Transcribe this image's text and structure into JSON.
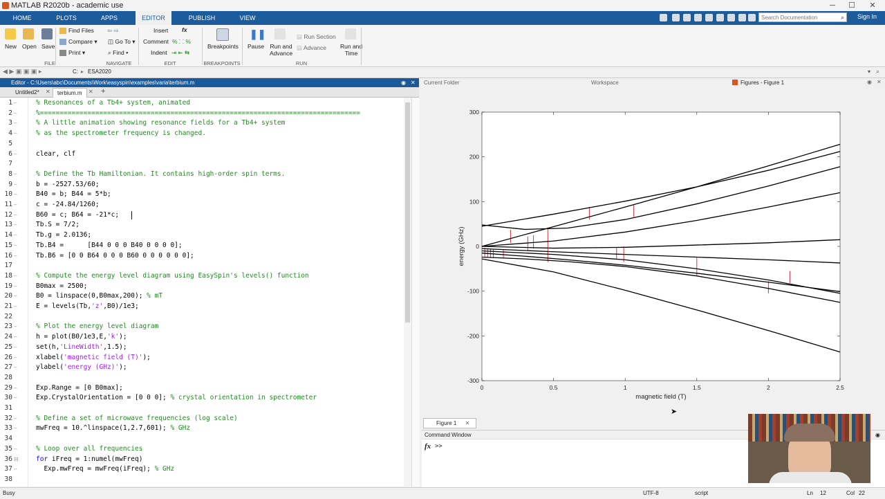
{
  "window": {
    "title": "MATLAB R2020b - academic use",
    "min": "─",
    "max": "☐",
    "close": "✕"
  },
  "ribbon": {
    "tabs": [
      "HOME",
      "PLOTS",
      "APPS",
      "EDITOR",
      "PUBLISH",
      "VIEW"
    ],
    "active_tab": "EDITOR",
    "search_placeholder": "Search Documentation",
    "sign_in": "Sign In"
  },
  "toolstrip": {
    "file": {
      "new": "New",
      "open": "Open",
      "save": "Save",
      "group": "FILE"
    },
    "navigate": {
      "find_files": "Find Files",
      "compare": "Compare",
      "print": "Print",
      "go_to": "Go To",
      "find": "Find",
      "group": "NAVIGATE"
    },
    "edit": {
      "insert": "Insert",
      "comment": "Comment",
      "indent": "Indent",
      "fx": "fx",
      "group": "EDIT"
    },
    "breakpoints": {
      "label": "Breakpoints",
      "group": "BREAKPOINTS"
    },
    "run": {
      "pause": "Pause",
      "run_advance_1": "Run and",
      "run_advance_2": "Advance",
      "run_section": "Run Section",
      "advance": "Advance",
      "run_time_1": "Run and",
      "run_time_2": "Time",
      "group": "RUN"
    }
  },
  "address": {
    "drive": "C:",
    "folder": "ESA2020"
  },
  "editor": {
    "title": "Editor - C:\\Users\\abc\\Documents\\Work\\easyspin\\examples\\varia\\terbium.m",
    "tabs": [
      "Untitled2*",
      "terbium.m"
    ],
    "active_tab": "terbium.m",
    "lines": [
      {
        "n": "1",
        "c": "% Resonances of a Tb4+ system, animated",
        "t": "cmt"
      },
      {
        "n": "2",
        "c": "%=================================================================================",
        "t": "cmt"
      },
      {
        "n": "3",
        "c": "% A little animation showing resonance fields for a Tb4+ system",
        "t": "cmt"
      },
      {
        "n": "4",
        "c": "% as the spectrometer frequency is changed.",
        "t": "cmt"
      },
      {
        "n": "5",
        "c": "",
        "t": ""
      },
      {
        "n": "6",
        "c": "clear, clf",
        "t": ""
      },
      {
        "n": "7",
        "c": "",
        "t": ""
      },
      {
        "n": "8",
        "c": "% Define the Tb Hamiltonian. It contains high-order spin terms.",
        "t": "cmt"
      },
      {
        "n": "9",
        "c": "b = -2527.53/60;",
        "t": ""
      },
      {
        "n": "10",
        "c": "B40 = b; B44 = 5*b;",
        "t": ""
      },
      {
        "n": "11",
        "c": "c = -24.84/1260;",
        "t": ""
      },
      {
        "n": "12",
        "c": "B60 = c; B64 = -21*c;",
        "t": ""
      },
      {
        "n": "13",
        "c": "Tb.S = 7/2;",
        "t": ""
      },
      {
        "n": "14",
        "c": "Tb.g = 2.0136;",
        "t": ""
      },
      {
        "n": "15",
        "c": "Tb.B4 =      [B44 0 0 0 B40 0 0 0 0];",
        "t": ""
      },
      {
        "n": "16",
        "c": "Tb.B6 = [0 0 B64 0 0 0 B60 0 0 0 0 0 0];",
        "t": ""
      },
      {
        "n": "17",
        "c": "",
        "t": ""
      },
      {
        "n": "18",
        "c": "% Compute the energy level diagram using EasySpin's levels() function",
        "t": "cmt"
      },
      {
        "n": "19",
        "c": "B0max = 2500;",
        "t": ""
      },
      {
        "n": "20",
        "c": "B0 = linspace(0,B0max,200); % mT",
        "t": "mixcmt",
        "p1": "B0 = linspace(0,B0max,200); ",
        "p2": "% mT"
      },
      {
        "n": "21",
        "c": "E = levels(Tb,'z',B0)/1e3;",
        "t": "mixstr",
        "p1": "E = levels(Tb,",
        "p2": "'z'",
        "p3": ",B0)/1e3;"
      },
      {
        "n": "22",
        "c": "",
        "t": ""
      },
      {
        "n": "23",
        "c": "% Plot the energy level diagram",
        "t": "cmt"
      },
      {
        "n": "24",
        "c": "h = plot(B0/1e3,E,'k');",
        "t": "mixstr",
        "p1": "h = plot(B0/1e3,E,",
        "p2": "'k'",
        "p3": ");"
      },
      {
        "n": "25",
        "c": "set(h,'LineWidth',1.5);",
        "t": "mixstr",
        "p1": "set(h,",
        "p2": "'LineWidth'",
        "p3": ",1.5);"
      },
      {
        "n": "26",
        "c": "xlabel('magnetic field (T)');",
        "t": "mixstr",
        "p1": "xlabel(",
        "p2": "'magnetic field (T)'",
        "p3": ");"
      },
      {
        "n": "27",
        "c": "ylabel('energy (GHz)');",
        "t": "mixstr",
        "p1": "ylabel(",
        "p2": "'energy (GHz)'",
        "p3": ");"
      },
      {
        "n": "28",
        "c": "",
        "t": ""
      },
      {
        "n": "29",
        "c": "Exp.Range = [0 B0max];",
        "t": ""
      },
      {
        "n": "30",
        "c": "Exp.CrystalOrientation = [0 0 0]; % crystal orientation in spectrometer",
        "t": "mixcmt",
        "p1": "Exp.CrystalOrientation = [0 0 0]; ",
        "p2": "% crystal orientation in spectrometer"
      },
      {
        "n": "31",
        "c": "",
        "t": ""
      },
      {
        "n": "32",
        "c": "% Define a set of microwave frequencies (log scale)",
        "t": "cmt"
      },
      {
        "n": "33",
        "c": "mwFreq = 10.^linspace(1,2.7,601); % GHz",
        "t": "mixcmt",
        "p1": "mwFreq = 10.^linspace(1,2.7,601); ",
        "p2": "% GHz"
      },
      {
        "n": "34",
        "c": "",
        "t": ""
      },
      {
        "n": "35",
        "c": "% Loop over all frequencies",
        "t": "cmt"
      },
      {
        "n": "36",
        "c": "for iFreq = 1:numel(mwFreq)",
        "t": "mixkw",
        "p1": "for",
        "p2": " iFreq = 1:numel(mwFreq)"
      },
      {
        "n": "37",
        "c": "  Exp.mwFreq = mwFreq(iFreq); % GHz",
        "t": "mixcmt",
        "p1": "  Exp.mwFreq = mwFreq(iFreq); ",
        "p2": "% GHz"
      },
      {
        "n": "38",
        "c": "",
        "t": ""
      }
    ]
  },
  "panels": {
    "current_folder": "Current Folder",
    "workspace": "Workspace",
    "figures": "Figures - Figure 1",
    "figure_tab": "Figure 1"
  },
  "command_window": {
    "title": "Command Window",
    "prompt": ">>",
    "fx": "fx"
  },
  "status": {
    "left": "Busy",
    "encoding": "UTF-8",
    "type": "script",
    "ln_label": "Ln",
    "ln": "12",
    "col_label": "Col",
    "col": "22"
  },
  "chart_data": {
    "type": "line",
    "xlabel": "magnetic field (T)",
    "ylabel": "energy (GHz)",
    "xlim": [
      0,
      2.5
    ],
    "ylim": [
      -300,
      300
    ],
    "xticks": [
      "0",
      "0.5",
      "1",
      "1.5",
      "2",
      "2.5"
    ],
    "yticks": [
      "-300",
      "-200",
      "-100",
      "0",
      "100",
      "200",
      "300"
    ],
    "line_color": "#000000",
    "marker_color": "#d8323c",
    "series": [
      {
        "x": [
          0,
          0.3,
          0.6,
          1.0,
          1.5,
          2.0,
          2.5
        ],
        "y": [
          48,
          38,
          41,
          60,
          95,
          135,
          178
        ]
      },
      {
        "x": [
          0,
          0.5,
          1.0,
          1.5,
          2.0,
          2.5
        ],
        "y": [
          0,
          44,
          88,
          133,
          180,
          228
        ]
      },
      {
        "x": [
          0,
          0.5,
          1.0,
          1.5,
          2.0,
          2.5
        ],
        "y": [
          45,
          72,
          101,
          133,
          170,
          212
        ]
      },
      {
        "x": [
          0,
          0.5,
          1.0,
          1.5,
          2.0,
          2.5
        ],
        "y": [
          0,
          12,
          32,
          58,
          88,
          120
        ]
      },
      {
        "x": [
          0,
          0.5,
          1.0,
          1.5,
          2.0,
          2.5
        ],
        "y": [
          0,
          -4,
          -2,
          3,
          8,
          15
        ]
      },
      {
        "x": [
          0,
          0.5,
          1.0,
          1.5,
          2.0,
          2.5
        ],
        "y": [
          -5,
          -12,
          -18,
          -24,
          -30,
          -37
        ]
      },
      {
        "x": [
          0,
          0.3,
          0.6,
          1.0,
          1.5,
          2.0,
          2.5
        ],
        "y": [
          -15,
          -22,
          -30,
          -42,
          -60,
          -80,
          -101
        ]
      },
      {
        "x": [
          0,
          0.3,
          0.6,
          1.0,
          1.5,
          2.0,
          2.5
        ],
        "y": [
          -24,
          -28,
          -34,
          -45,
          -66,
          -94,
          -125
        ]
      },
      {
        "x": [
          0,
          0.5,
          1.0,
          1.5,
          2.0,
          2.5
        ],
        "y": [
          -28,
          -57,
          -98,
          -142,
          -188,
          -236
        ]
      },
      {
        "x": [
          0,
          0.5,
          1.0,
          1.5,
          2.0,
          2.5
        ],
        "y": [
          -10,
          -18,
          -30,
          -50,
          -75,
          -105
        ]
      }
    ],
    "resonances": [
      {
        "x": 0.02,
        "y1": -3,
        "y2": -23
      },
      {
        "x": 0.04,
        "y1": -4,
        "y2": -24
      },
      {
        "x": 0.06,
        "y1": -5,
        "y2": -25
      },
      {
        "x": 0.08,
        "y1": -6,
        "y2": -26
      },
      {
        "x": 0.15,
        "y1": -8,
        "y2": -27
      },
      {
        "x": 0.2,
        "y1": 37,
        "y2": 8
      },
      {
        "x": 0.32,
        "y1": 22,
        "y2": -8
      },
      {
        "x": 0.36,
        "y1": 25,
        "y2": -5
      },
      {
        "x": 0.46,
        "y1": 42,
        "y2": -35
      },
      {
        "x": 0.75,
        "y1": 88,
        "y2": 60
      },
      {
        "x": 0.94,
        "y1": -2,
        "y2": -30
      },
      {
        "x": 0.99,
        "y1": 0,
        "y2": -35
      },
      {
        "x": 1.06,
        "y1": 92,
        "y2": 66
      },
      {
        "x": 1.5,
        "y1": -25,
        "y2": -65
      },
      {
        "x": 2.0,
        "y1": -78,
        "y2": -105
      },
      {
        "x": 2.15,
        "y1": -55,
        "y2": -82
      }
    ]
  },
  "webcam": {
    "label": "presenter webcam"
  }
}
